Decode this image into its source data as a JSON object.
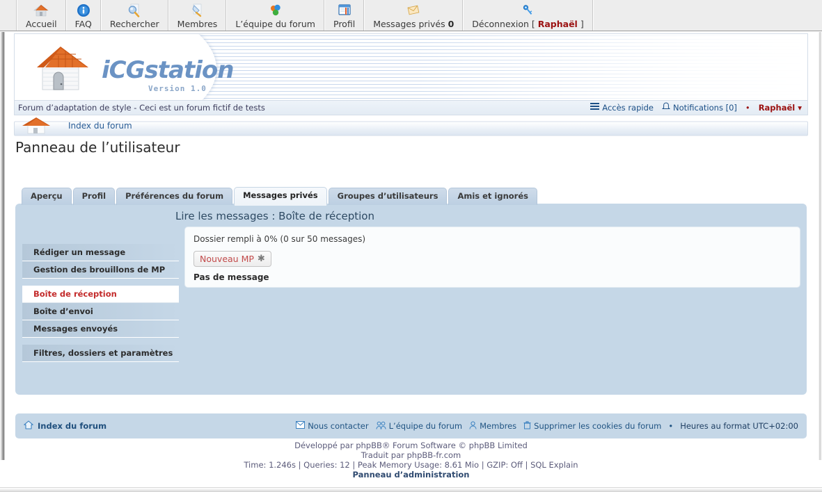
{
  "topnav": {
    "items": [
      {
        "label": "Accueil",
        "icon": "home-icon"
      },
      {
        "label": "FAQ",
        "icon": "info-icon"
      },
      {
        "label": "Rechercher",
        "icon": "magnifier-icon"
      },
      {
        "label": "Membres",
        "icon": "members-icon"
      },
      {
        "label": "L’équipe du forum",
        "icon": "team-icon"
      },
      {
        "label": "Profil",
        "icon": "profile-icon"
      },
      {
        "label": "Messages privés",
        "count": "0",
        "icon": "envelope-icon"
      },
      {
        "label": "Déconnexion [",
        "username": "Raphaël",
        "label_end": "]",
        "icon": "key-icon"
      }
    ]
  },
  "banner": {
    "logo_text": "iCGstation",
    "version": "Version 1.0",
    "logo_icon": "house-logo-icon"
  },
  "descbar": {
    "site_description": "Forum d’adaptation de style - Ceci est un forum fictif de tests",
    "quick_access": "Accès rapide",
    "notifications": "Notifications [0]",
    "notifications_count": "0",
    "bullet": "•",
    "username": "Raphaël ▾"
  },
  "breadcrumb": {
    "index_label": "Index du forum",
    "icon": "house-breadcrumb-icon"
  },
  "page": {
    "title": "Panneau de l’utilisateur"
  },
  "tabs": [
    {
      "label": "Aperçu",
      "active": false
    },
    {
      "label": "Profil",
      "active": false
    },
    {
      "label": "Préférences du forum",
      "active": false
    },
    {
      "label": "Messages privés",
      "active": true
    },
    {
      "label": "Groupes d’utilisateurs",
      "active": false
    },
    {
      "label": "Amis et ignorés",
      "active": false
    }
  ],
  "panel": {
    "title": "Lire les messages : Boîte de réception",
    "folder_stat": "Dossier rempli à 0% (0 sur 50 messages)",
    "new_pm_button": "Nouveau MP",
    "new_pm_star": "✱",
    "no_message": "Pas de message"
  },
  "sidemenu": {
    "groups": [
      {
        "items": [
          {
            "label": "Rédiger un message",
            "current": false
          },
          {
            "label": "Gestion des brouillons de MP",
            "current": false
          }
        ]
      },
      {
        "items": [
          {
            "label": "Boîte de réception",
            "current": true
          },
          {
            "label": "Boîte d’envoi",
            "current": false
          },
          {
            "label": "Messages envoyés",
            "current": false
          }
        ]
      },
      {
        "items": [
          {
            "label": "Filtres, dossiers et paramètres",
            "current": false
          }
        ]
      }
    ]
  },
  "footer": {
    "home_label": "Index du forum",
    "links": [
      {
        "label": "Nous contacter",
        "icon": "envelope-icon"
      },
      {
        "label": "L’équipe du forum",
        "icon": "team-icon"
      },
      {
        "label": "Membres",
        "icon": "person-icon"
      },
      {
        "label": "Supprimer les cookies du forum",
        "icon": "trash-icon"
      }
    ],
    "bullet": "•",
    "timezone": "Heures au format UTC+02:00"
  },
  "credits": {
    "line1": "Développé par phpBB® Forum Software © phpBB Limited",
    "line2": "Traduit par phpBB-fr.com",
    "line3": "Time: 1.246s | Queries: 12 | Peak Memory Usage: 8.61 Mio | GZIP: Off | SQL Explain",
    "line4": "Panneau d’administration"
  },
  "colors": {
    "panel_blue": "#c5d7e7",
    "accent_red": "#9b1111",
    "link_blue": "#1f5382",
    "logo_blue": "#6b93c4",
    "current_red": "#c32b2b"
  }
}
